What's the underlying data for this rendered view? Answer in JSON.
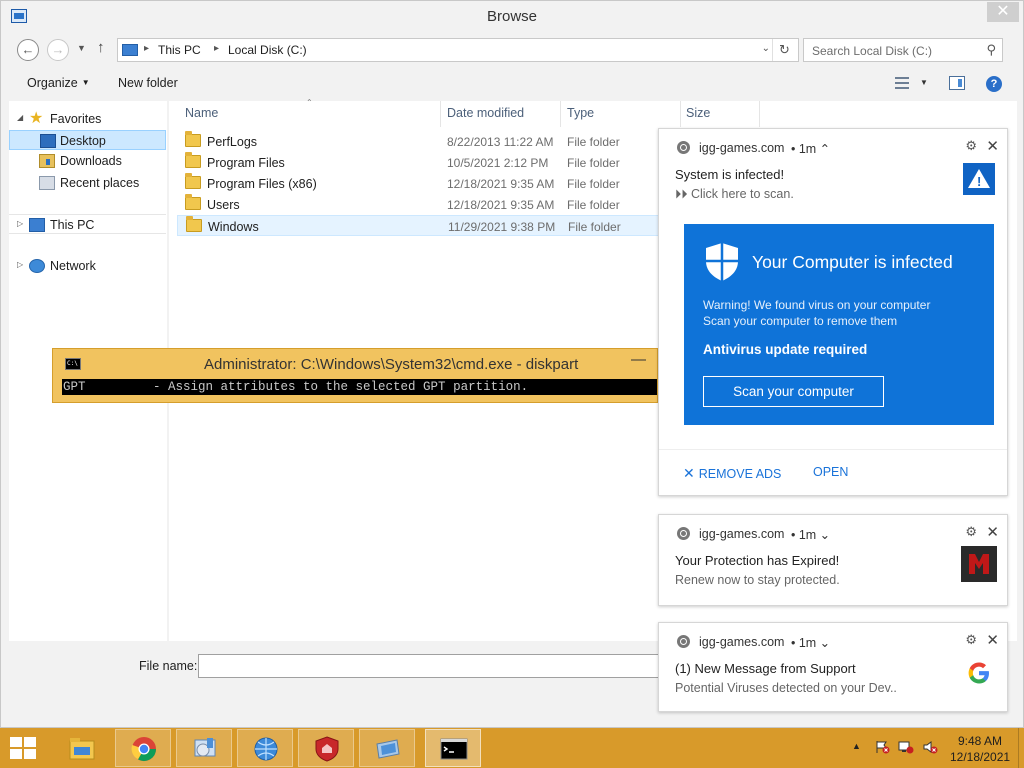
{
  "window": {
    "title": "Browse",
    "close_glyph": "✕"
  },
  "address": {
    "crumbs": [
      "This PC",
      "Local Disk (C:)"
    ],
    "search_placeholder": "Search Local Disk (C:)"
  },
  "toolbar": {
    "organize": "Organize",
    "new_folder": "New folder"
  },
  "nav": {
    "items": [
      {
        "label": "Favorites",
        "icon": "star-icon"
      },
      {
        "label": "Desktop",
        "icon": "desktop-icon"
      },
      {
        "label": "Downloads",
        "icon": "downloads-icon"
      },
      {
        "label": "Recent places",
        "icon": "recent-places-icon"
      },
      {
        "label": "This PC",
        "icon": "this-pc-icon"
      },
      {
        "label": "Network",
        "icon": "network-icon"
      }
    ]
  },
  "columns": {
    "name": "Name",
    "date": "Date modified",
    "type": "Type",
    "size": "Size"
  },
  "files": [
    {
      "name": "PerfLogs",
      "date": "8/22/2013 11:22 AM",
      "type": "File folder"
    },
    {
      "name": "Program Files",
      "date": "10/5/2021 2:12 PM",
      "type": "File folder"
    },
    {
      "name": "Program Files (x86)",
      "date": "12/18/2021 9:35 AM",
      "type": "File folder"
    },
    {
      "name": "Users",
      "date": "12/18/2021 9:35 AM",
      "type": "File folder"
    },
    {
      "name": "Windows",
      "date": "11/29/2021 9:38 PM",
      "type": "File folder"
    }
  ],
  "filename": {
    "label": "File name:",
    "value": ""
  },
  "cmd": {
    "title": "Administrator: C:\\Windows\\System32\\cmd.exe - diskpart",
    "line": "GPT         - Assign attributes to the selected GPT partition."
  },
  "notifications": [
    {
      "site": "igg-games.com",
      "age": "• 1m ⌃",
      "title": "System is infected!",
      "body": "⏵⏵ Click here to scan.",
      "icon": "warning-icon",
      "ad": {
        "heading": "Your Computer is infected",
        "warning1": "Warning! We found virus on your computer",
        "warning2": "Scan your computer to remove them",
        "subheading": "Antivirus update required",
        "button": "Scan your computer"
      },
      "actions": {
        "remove_ads": "REMOVE ADS",
        "open": "OPEN"
      }
    },
    {
      "site": "igg-games.com",
      "age": "• 1m ⌄",
      "title": "Your Protection has Expired!",
      "body": "Renew now to stay protected.",
      "icon": "mcafee-icon"
    },
    {
      "site": "igg-games.com",
      "age": "• 1m ⌄",
      "title": "(1) New Message from Support",
      "body": "Potential Viruses detected on your Dev..",
      "icon": "google-icon"
    }
  ],
  "taskbar": {
    "apps": [
      "file-explorer-icon",
      "chrome-icon",
      "control-panel-icon",
      "network-globe-icon",
      "security-shield-icon",
      "remote-desktop-icon",
      "cmd-icon"
    ],
    "clock_time": "9:48 AM",
    "clock_date": "12/18/2021"
  },
  "colors": {
    "taskbar": "#d89a2a",
    "cmd_titlebar": "#f1c35f",
    "ad_banner": "#0f73d8",
    "link_blue": "#1a73d9",
    "selection": "#cce8ff"
  }
}
